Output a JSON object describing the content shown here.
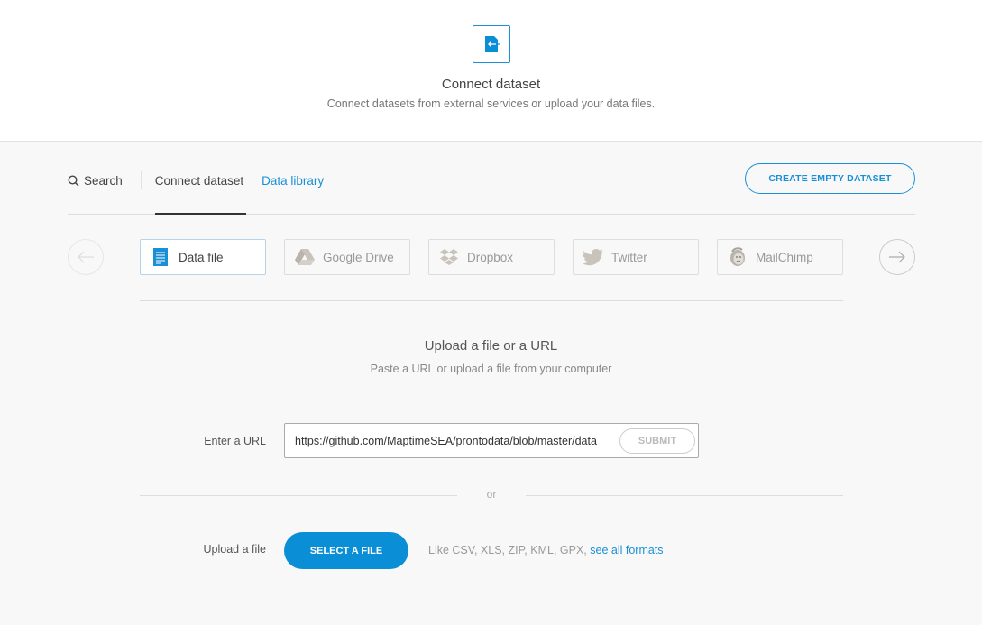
{
  "header": {
    "icon": "connect-dataset-icon",
    "title": "Connect dataset",
    "subtitle": "Connect datasets from external services or upload your data files."
  },
  "nav": {
    "search_label": "Search",
    "tabs": [
      {
        "label": "Connect dataset",
        "active": true
      },
      {
        "label": "Data library",
        "active": false
      }
    ],
    "create_button": "CREATE EMPTY DATASET"
  },
  "sources": [
    {
      "label": "Data file",
      "icon": "document-icon",
      "active": true
    },
    {
      "label": "Google Drive",
      "icon": "google-drive-icon",
      "active": false
    },
    {
      "label": "Dropbox",
      "icon": "dropbox-icon",
      "active": false
    },
    {
      "label": "Twitter",
      "icon": "twitter-icon",
      "active": false
    },
    {
      "label": "MailChimp",
      "icon": "mailchimp-icon",
      "active": false
    }
  ],
  "upload": {
    "title": "Upload a file or a URL",
    "subtitle": "Paste a URL or upload a file from your computer",
    "url_label": "Enter a URL",
    "url_value": "https://github.com/MaptimeSEA/prontodata/blob/master/data",
    "submit_label": "SUBMIT",
    "or_label": "or",
    "file_label": "Upload a file",
    "select_button": "SELECT A FILE",
    "formats_text": "Like CSV, XLS, ZIP, KML, GPX,",
    "formats_link": "see all formats"
  },
  "colors": {
    "accent": "#0a8fd6",
    "link": "#1a8fd6",
    "background": "#f8f8f8"
  }
}
